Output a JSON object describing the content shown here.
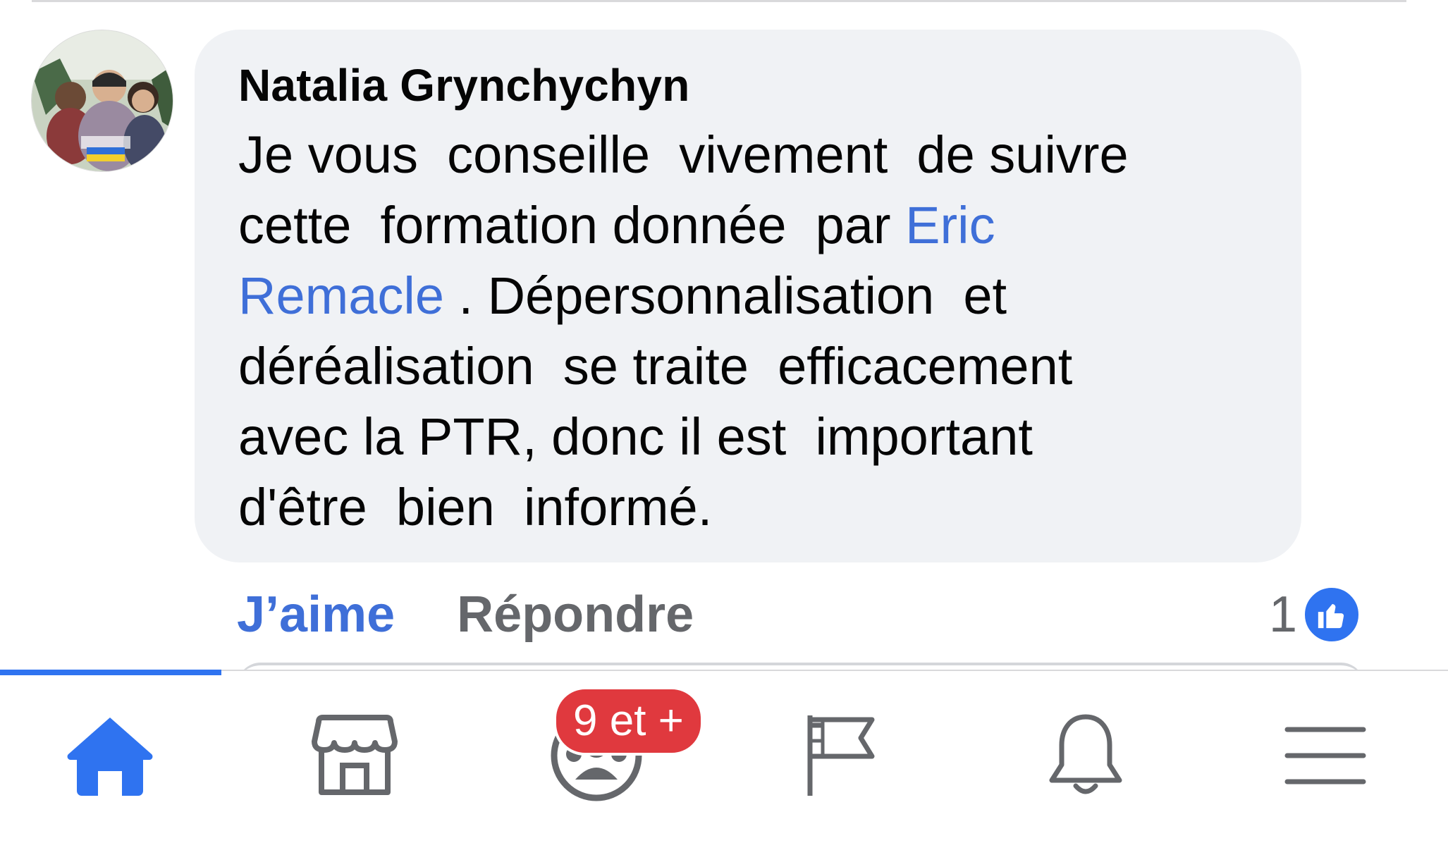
{
  "comment": {
    "author": "Natalia Grynchychyn",
    "text_before_mention": "Je vous  conseille  vivement  de suivre\ncette  formation donnée  par ",
    "mention": "Eric\nRemacle",
    "text_after_mention": " . Dépersonnalisation  et\ndéréalisation  se traite  efficacement\navec la PTR, donc il est  important\nd'être  bien  informé.",
    "actions": {
      "like_label": "J’aime",
      "reply_label": "Répondre"
    },
    "reactions": {
      "count": "1",
      "icon": "like-icon"
    }
  },
  "tabbar": {
    "active_tab": "home",
    "tabs": [
      {
        "id": "home",
        "icon": "home-icon"
      },
      {
        "id": "marketplace",
        "icon": "marketplace-icon"
      },
      {
        "id": "groups",
        "icon": "groups-icon",
        "badge": "9 et +"
      },
      {
        "id": "pages",
        "icon": "flag-icon"
      },
      {
        "id": "notifications",
        "icon": "bell-icon"
      },
      {
        "id": "menu",
        "icon": "menu-icon"
      }
    ]
  },
  "colors": {
    "accent": "#3f6fd8",
    "bubble": "#f0f2f5",
    "secondary_text": "#65676b",
    "badge": "#e0393e",
    "tab_icon": "#65676b"
  }
}
